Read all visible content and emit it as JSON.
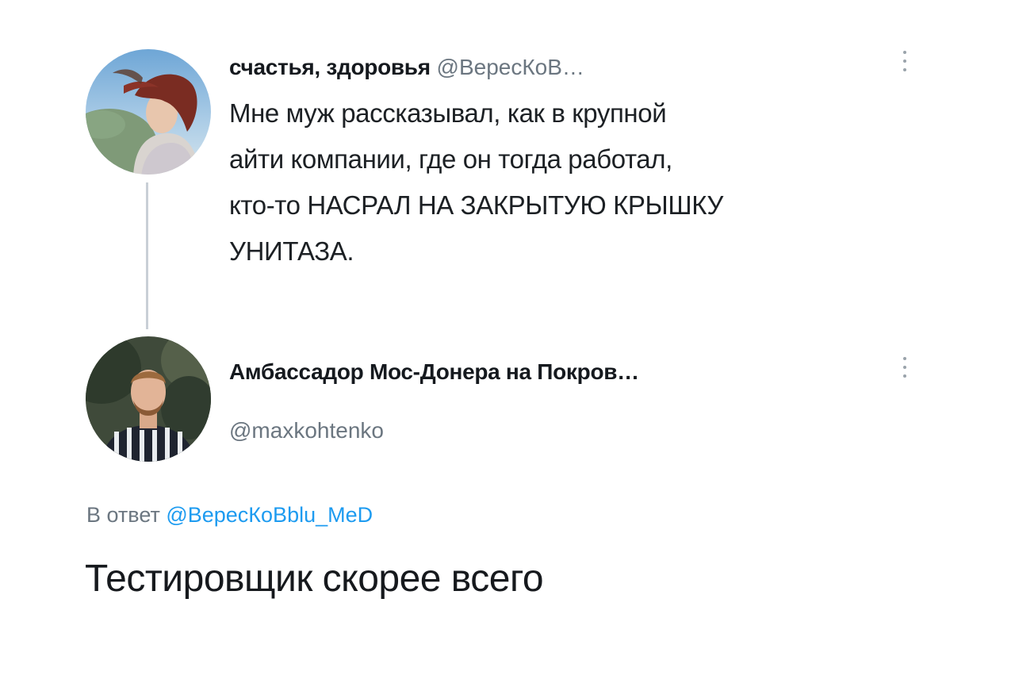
{
  "original_tweet": {
    "author_name": "счастья, здоровья",
    "handle": "@ВересКоВ…",
    "text_lines": [
      "Мне муж рассказывал, как в крупной",
      "айти компании, где он тогда работал,",
      "кто-то НАСРАЛ НА ЗАКРЫТУЮ КРЫШКУ",
      "УНИТАЗА."
    ]
  },
  "reply_tweet": {
    "author_name": "Амбассадор Мос-Донера на Покров…",
    "handle": "@maxkohtenko",
    "reply_to_prefix": "В ответ",
    "reply_to_handle": "@ВересКоBblu_MeD",
    "text": "Тестировщик скорее всего"
  },
  "colors": {
    "handle_gray": "#6b7680",
    "mention_blue": "#1d9bf0",
    "thread_line": "#c9cfd6"
  }
}
